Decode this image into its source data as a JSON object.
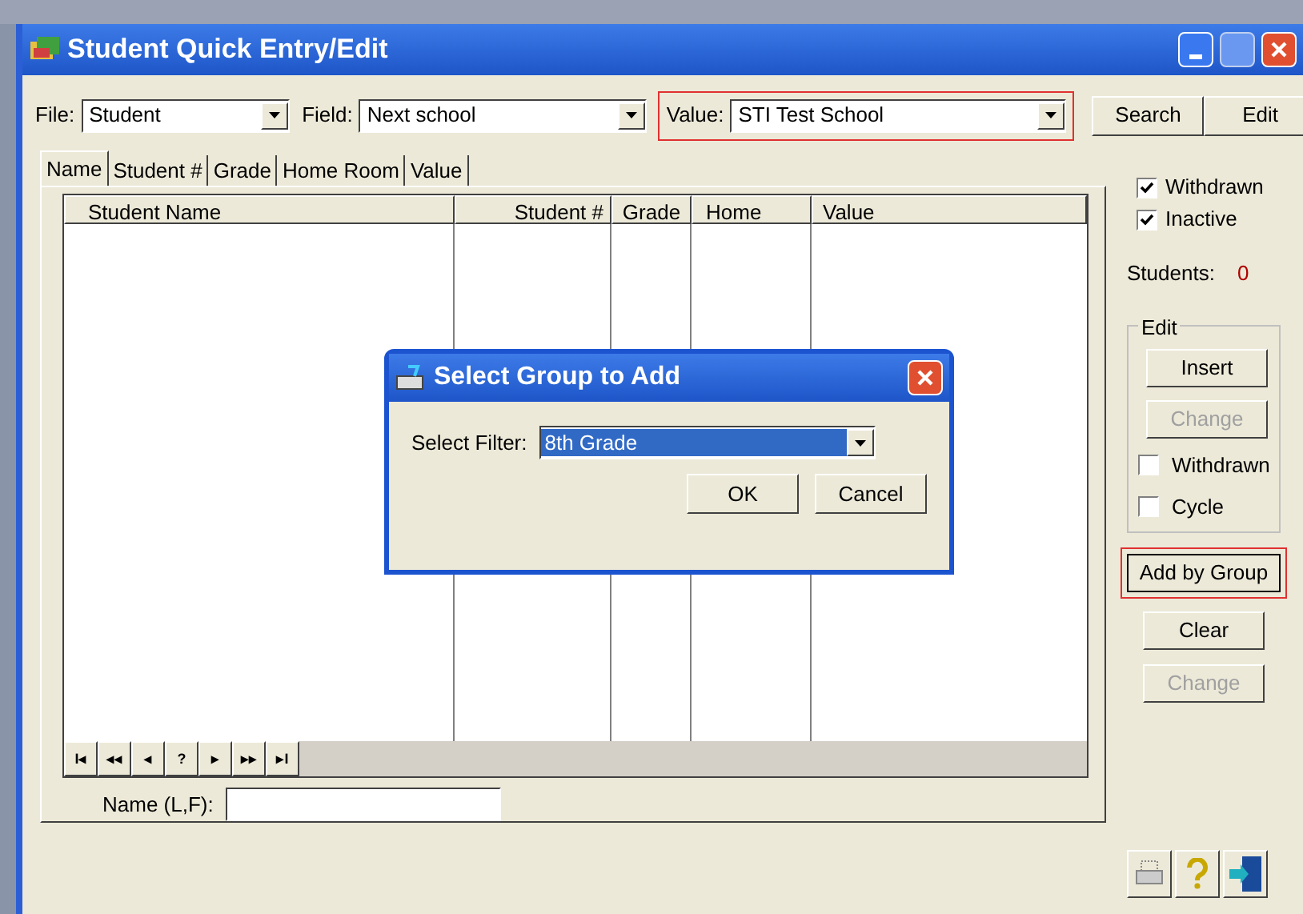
{
  "window": {
    "title": "Student Quick Entry/Edit"
  },
  "toolbar": {
    "fields": [
      {
        "label": "File:",
        "value": "Student",
        "highlighted": false
      },
      {
        "label": "Field:",
        "value": "Next school",
        "highlighted": false
      },
      {
        "label": "Value:",
        "value": "STI Test School",
        "highlighted": true
      }
    ],
    "buttons": [
      "Search",
      "Edit"
    ]
  },
  "tabs": [
    {
      "label": "Name",
      "selected": true
    },
    {
      "label": "Student #",
      "selected": false
    },
    {
      "label": "Grade",
      "selected": false
    },
    {
      "label": "Home Room",
      "selected": false
    },
    {
      "label": "Value",
      "selected": false
    }
  ],
  "table": {
    "columns": [
      "Student Name",
      "Student #",
      "Grade",
      "Home",
      "Value"
    ]
  },
  "navigator": [
    "I◂",
    "◂◂",
    "◂",
    "?",
    "▸",
    "▸▸",
    "▸I"
  ],
  "name_field": {
    "label": "Name (L,F):"
  },
  "filters": [
    {
      "label": "Withdrawn",
      "checked": true
    },
    {
      "label": "Inactive",
      "checked": true
    }
  ],
  "students": {
    "label": "Students:",
    "count": "0"
  },
  "edit_group": {
    "title": "Edit",
    "items": [
      {
        "kind": "button",
        "label": "Insert",
        "disabled": false
      },
      {
        "kind": "button",
        "label": "Change",
        "disabled": true
      },
      {
        "kind": "checkbox",
        "label": "Withdrawn",
        "checked": false
      },
      {
        "kind": "checkbox",
        "label": "Cycle",
        "checked": false
      }
    ]
  },
  "actions": [
    {
      "label": "Add by Group",
      "disabled": false,
      "highlighted": true
    },
    {
      "label": "Clear",
      "disabled": false,
      "highlighted": false
    },
    {
      "label": "Change",
      "disabled": true,
      "highlighted": false
    }
  ],
  "dialog": {
    "title": "Select Group to Add",
    "filter_label": "Select Filter:",
    "filter_value": "8th Grade",
    "buttons": [
      "OK",
      "Cancel"
    ]
  }
}
